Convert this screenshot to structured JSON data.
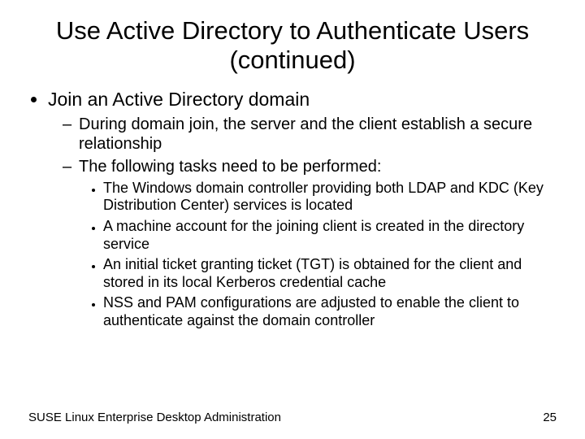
{
  "title": "Use Active Directory to Authenticate Users (continued)",
  "l1": {
    "item0": "Join an Active Directory domain"
  },
  "l2": {
    "item0": "During domain join, the server and the client establish a secure relationship",
    "item1": "The following tasks need to be performed:"
  },
  "l3": {
    "item0": "The Windows domain controller providing both LDAP and KDC (Key Distribution Center) services is located",
    "item1": "A machine account for the joining client is created in the directory service",
    "item2": "An initial ticket granting ticket (TGT) is obtained for the client and stored in its local Kerberos credential cache",
    "item3": "NSS and PAM configurations are adjusted to enable the client to authenticate against the domain controller"
  },
  "footer": {
    "left": "SUSE Linux Enterprise Desktop Administration",
    "right": "25"
  }
}
